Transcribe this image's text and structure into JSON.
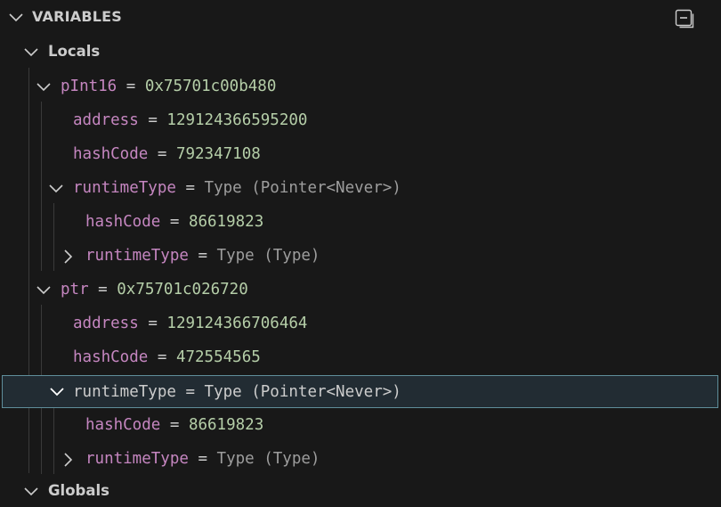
{
  "panel": {
    "title": "VARIABLES",
    "collapse_icon": "collapse-all-icon"
  },
  "scopes": {
    "locals": "Locals",
    "globals": "Globals"
  },
  "eq": "=",
  "rows": [
    {
      "name": "pInt16",
      "value": "0x75701c00b480"
    },
    {
      "name": "address",
      "value": "129124366595200"
    },
    {
      "name": "hashCode",
      "value": "792347108"
    },
    {
      "name": "runtimeType",
      "value": "Type (Pointer<Never>)"
    },
    {
      "name": "hashCode",
      "value": "86619823"
    },
    {
      "name": "runtimeType",
      "value": "Type (Type)"
    },
    {
      "name": "ptr",
      "value": "0x75701c026720"
    },
    {
      "name": "address",
      "value": "129124366706464"
    },
    {
      "name": "hashCode",
      "value": "472554565"
    },
    {
      "name": "runtimeType",
      "value": "Type (Pointer<Never>)"
    },
    {
      "name": "hashCode",
      "value": "86619823"
    },
    {
      "name": "runtimeType",
      "value": "Type (Type)"
    }
  ]
}
